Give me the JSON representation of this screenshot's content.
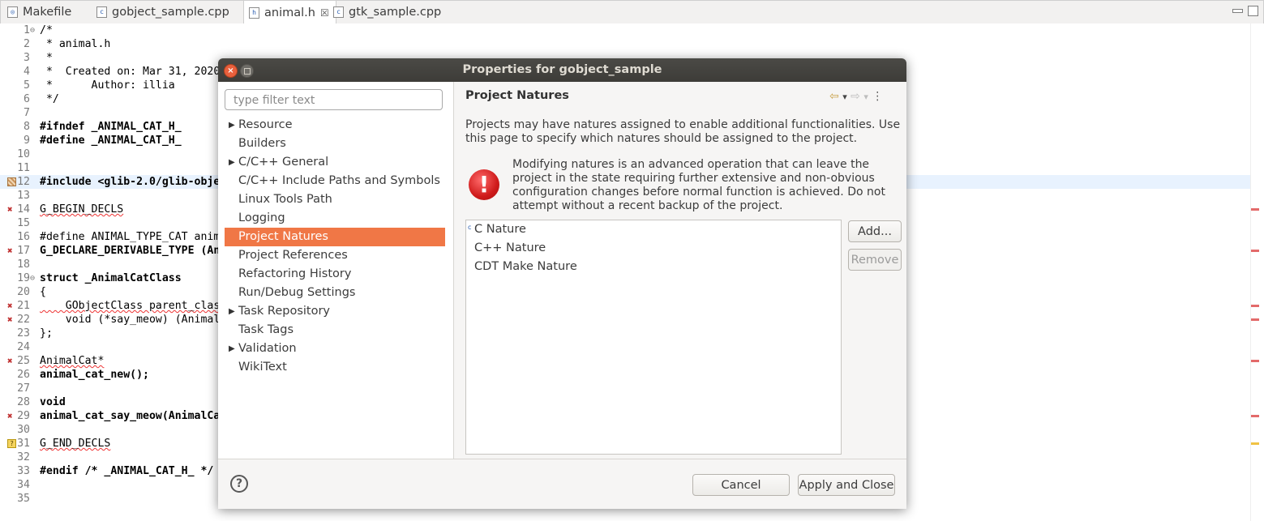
{
  "tabs": [
    {
      "label": "Makefile",
      "icon": "makefile-icon",
      "active": false
    },
    {
      "label": "gobject_sample.cpp",
      "icon": "cpp-file-icon",
      "active": false
    },
    {
      "label": "animal.h",
      "icon": "header-file-icon",
      "active": true,
      "close": "☒"
    },
    {
      "label": "gtk_sample.cpp",
      "icon": "cpp-file-icon",
      "active": false
    }
  ],
  "editor": {
    "lines": [
      {
        "n": "1",
        "text": "/*"
      },
      {
        "n": "2",
        "text": " * animal.h"
      },
      {
        "n": "3",
        "text": " *"
      },
      {
        "n": "4",
        "text": " *  Created on: Mar 31, 2020"
      },
      {
        "n": "5",
        "text": " *      Author: illia"
      },
      {
        "n": "6",
        "text": " */"
      },
      {
        "n": "7",
        "text": ""
      },
      {
        "n": "8",
        "text": "#ifndef _ANIMAL_CAT_H_"
      },
      {
        "n": "9",
        "text": "#define _ANIMAL_CAT_H_"
      },
      {
        "n": "10",
        "text": ""
      },
      {
        "n": "11",
        "text": ""
      },
      {
        "n": "12",
        "text": "#include <glib-2.0/glib-obje"
      },
      {
        "n": "13",
        "text": ""
      },
      {
        "n": "14",
        "text": "G_BEGIN_DECLS"
      },
      {
        "n": "15",
        "text": ""
      },
      {
        "n": "16",
        "text": "#define ANIMAL_TYPE_CAT anim"
      },
      {
        "n": "17",
        "text": "G_DECLARE_DERIVABLE_TYPE (An"
      },
      {
        "n": "18",
        "text": ""
      },
      {
        "n": "19",
        "text": "struct _AnimalCatClass"
      },
      {
        "n": "20",
        "text": "{"
      },
      {
        "n": "21",
        "text": "    GObjectClass parent_clas"
      },
      {
        "n": "22",
        "text": "    void (*say_meow) (Animal"
      },
      {
        "n": "23",
        "text": "};"
      },
      {
        "n": "24",
        "text": ""
      },
      {
        "n": "25",
        "text": "AnimalCat*"
      },
      {
        "n": "26",
        "text": "animal_cat_new();"
      },
      {
        "n": "27",
        "text": ""
      },
      {
        "n": "28",
        "text": "void"
      },
      {
        "n": "29",
        "text": "animal_cat_say_meow(AnimalCa"
      },
      {
        "n": "30",
        "text": ""
      },
      {
        "n": "31",
        "text": "G_END_DECLS"
      },
      {
        "n": "32",
        "text": ""
      },
      {
        "n": "33",
        "text": "#endif /* _ANIMAL_CAT_H_ */"
      },
      {
        "n": "34",
        "text": ""
      },
      {
        "n": "35",
        "text": ""
      }
    ]
  },
  "dialog": {
    "title": "Properties for gobject_sample",
    "close_glyph": "×",
    "filter_placeholder": "type filter text",
    "tree": [
      {
        "label": "Resource",
        "expandable": true
      },
      {
        "label": "Builders",
        "expandable": false
      },
      {
        "label": "C/C++ General",
        "expandable": true
      },
      {
        "label": "C/C++ Include Paths and Symbols",
        "expandable": false
      },
      {
        "label": "Linux Tools Path",
        "expandable": false
      },
      {
        "label": "Logging",
        "expandable": false
      },
      {
        "label": "Project Natures",
        "expandable": false,
        "selected": true
      },
      {
        "label": "Project References",
        "expandable": false
      },
      {
        "label": "Refactoring History",
        "expandable": false
      },
      {
        "label": "Run/Debug Settings",
        "expandable": false
      },
      {
        "label": "Task Repository",
        "expandable": true
      },
      {
        "label": "Task Tags",
        "expandable": false
      },
      {
        "label": "Validation",
        "expandable": true
      },
      {
        "label": "WikiText",
        "expandable": false
      }
    ],
    "page_title": "Project Natures",
    "nav": {
      "back": "⇦",
      "forward": "⇨",
      "dropdown": "▾",
      "menu": "⋮"
    },
    "description": "Projects may have natures assigned to enable additional functionalities. Use this page to specify which natures should be assigned to the project.",
    "warning_glyph": "!",
    "warning": "Modifying natures is an advanced operation that can leave the project in the state requiring further extensive and non-obvious configuration changes before normal function is achieved. Do not attempt without a recent backup of the project.",
    "natures": [
      {
        "label": "C Nature",
        "badge": "c"
      },
      {
        "label": "C++ Nature",
        "badge": ""
      },
      {
        "label": "CDT Make Nature",
        "badge": ""
      }
    ],
    "add_button": "Add...",
    "remove_button": "Remove",
    "help_glyph": "?",
    "cancel_button": "Cancel",
    "apply_close_button": "Apply and Close"
  },
  "colors": {
    "selection": "#f07746",
    "titlebar": "#3d3c38",
    "error_icon": "#cf1b1b",
    "current_line": "#e8f2fe"
  }
}
